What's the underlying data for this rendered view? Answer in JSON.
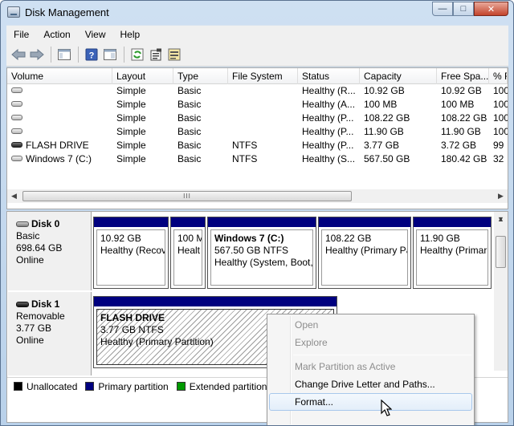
{
  "window": {
    "title": "Disk Management",
    "minimize": "—",
    "maximize": "□",
    "close": "✕"
  },
  "menu": [
    "File",
    "Action",
    "View",
    "Help"
  ],
  "toolbar": {
    "icons": [
      "back-arrow-icon",
      "forward-arrow-icon",
      "console-tree-icon",
      "help-icon",
      "help-pane-icon",
      "refresh-icon",
      "properties-icon",
      "rescan-icon"
    ]
  },
  "volumes": {
    "columns": [
      "Volume",
      "Layout",
      "Type",
      "File System",
      "Status",
      "Capacity",
      "Free Spa...",
      "% F"
    ],
    "rows": [
      {
        "volume": "",
        "layout": "Simple",
        "type": "Basic",
        "fs": "",
        "status": "Healthy (R...",
        "capacity": "10.92 GB",
        "free": "10.92 GB",
        "pct": "100"
      },
      {
        "volume": "",
        "layout": "Simple",
        "type": "Basic",
        "fs": "",
        "status": "Healthy (A...",
        "capacity": "100 MB",
        "free": "100 MB",
        "pct": "100"
      },
      {
        "volume": "",
        "layout": "Simple",
        "type": "Basic",
        "fs": "",
        "status": "Healthy (P...",
        "capacity": "108.22 GB",
        "free": "108.22 GB",
        "pct": "100"
      },
      {
        "volume": "",
        "layout": "Simple",
        "type": "Basic",
        "fs": "",
        "status": "Healthy (P...",
        "capacity": "11.90 GB",
        "free": "11.90 GB",
        "pct": "100"
      },
      {
        "volume": "FLASH DRIVE",
        "layout": "Simple",
        "type": "Basic",
        "fs": "NTFS",
        "status": "Healthy (P...",
        "capacity": "3.77 GB",
        "free": "3.72 GB",
        "pct": "99"
      },
      {
        "volume": "Windows 7 (C:)",
        "layout": "Simple",
        "type": "Basic",
        "fs": "NTFS",
        "status": "Healthy (S...",
        "capacity": "567.50 GB",
        "free": "180.42 GB",
        "pct": "32"
      }
    ],
    "scroll_grip": "III"
  },
  "disk0": {
    "name": "Disk 0",
    "kind": "Basic",
    "size": "698.64 GB",
    "state": "Online",
    "partitions": [
      {
        "title": "",
        "line1": "10.92 GB",
        "line2": "Healthy (Recov"
      },
      {
        "title": "",
        "line1": "100 M",
        "line2": "Healt"
      },
      {
        "title": "Windows 7  (C:)",
        "line1": "567.50 GB NTFS",
        "line2": "Healthy (System, Boot,"
      },
      {
        "title": "",
        "line1": "108.22 GB",
        "line2": "Healthy (Primary Pa"
      },
      {
        "title": "",
        "line1": "11.90 GB",
        "line2": "Healthy (Primar"
      }
    ]
  },
  "disk1": {
    "name": "Disk 1",
    "kind": "Removable",
    "size": "3.77 GB",
    "state": "Online",
    "partition": {
      "title": "FLASH DRIVE",
      "line1": "3.77 GB NTFS",
      "line2": "Healthy (Primary Partition)"
    }
  },
  "legend": [
    {
      "label": "Unallocated",
      "color": "#000000"
    },
    {
      "label": "Primary partition",
      "color": "#00007f"
    },
    {
      "label": "Extended partition",
      "color": "#009900"
    }
  ],
  "context_menu": {
    "open": "Open",
    "explore": "Explore",
    "mark_active": "Mark Partition as Active",
    "change_letter": "Change Drive Letter and Paths...",
    "format": "Format..."
  },
  "colors": {
    "primary_partition": "#00007f",
    "accent": "#b9d1ea"
  }
}
